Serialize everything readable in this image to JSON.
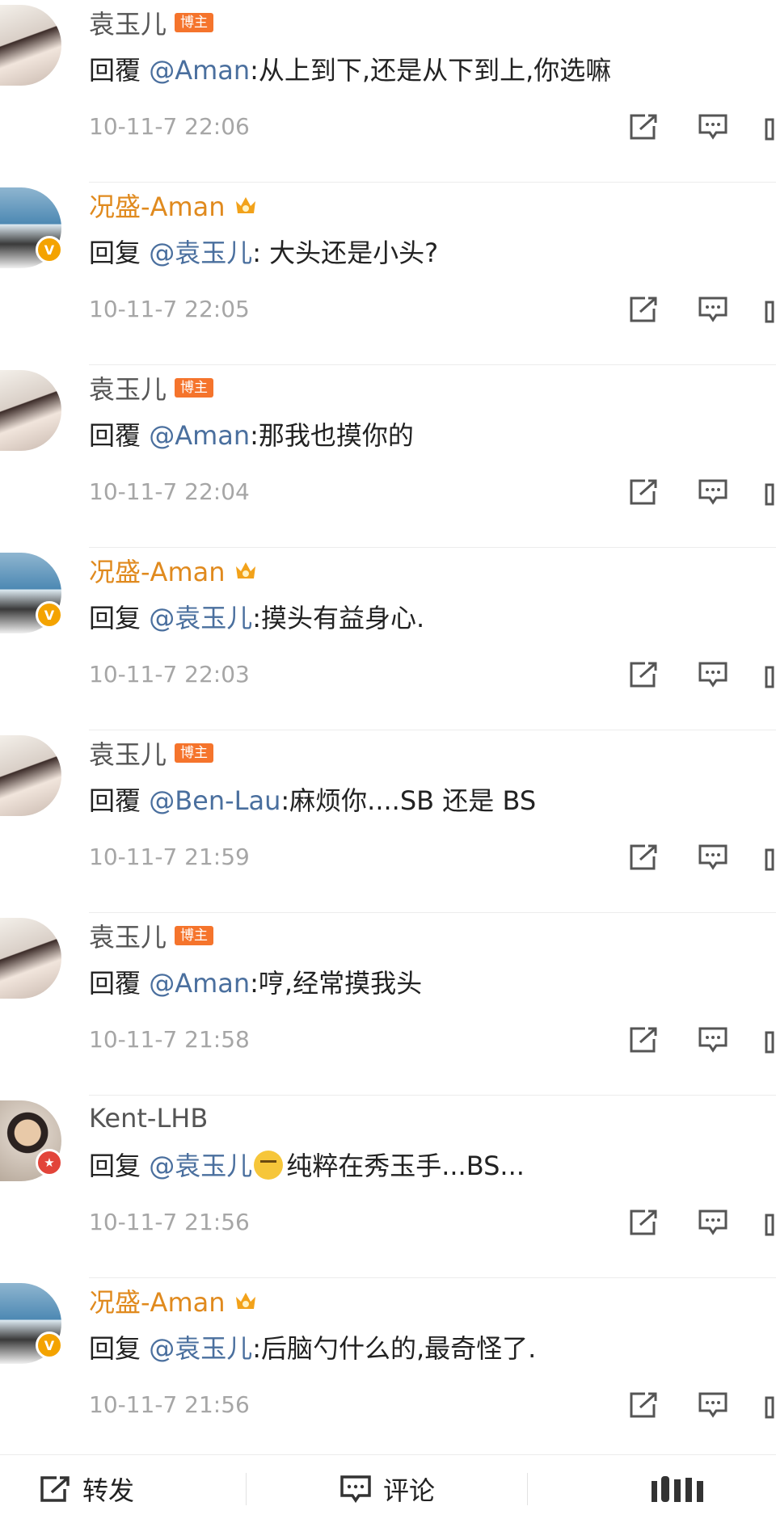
{
  "comments": [
    {
      "name": "袁玉儿",
      "name_color": "gray",
      "tag": "博主",
      "prefix": "回覆 ",
      "mention": "@Aman",
      "rest": ":从上到下,还是从下到上,你选嘛",
      "time": "10-11-7 22:06",
      "avatar": "girl",
      "badge": "none",
      "emoji": false
    },
    {
      "name": "况盛-Aman",
      "name_color": "orange",
      "tag": "",
      "prefix": "回复 ",
      "mention": "@袁玉儿",
      "rest": ": 大头还是小头?",
      "time": "10-11-7 22:05",
      "avatar": "sea",
      "badge": "v",
      "emoji": false
    },
    {
      "name": "袁玉儿",
      "name_color": "gray",
      "tag": "博主",
      "prefix": "回覆 ",
      "mention": "@Aman",
      "rest": ":那我也摸你的",
      "time": "10-11-7 22:04",
      "avatar": "girl",
      "badge": "none",
      "emoji": false
    },
    {
      "name": "况盛-Aman",
      "name_color": "orange",
      "tag": "",
      "prefix": "回复 ",
      "mention": "@袁玉儿",
      "rest": ":摸头有益身心.",
      "time": "10-11-7 22:03",
      "avatar": "sea",
      "badge": "v",
      "emoji": false
    },
    {
      "name": "袁玉儿",
      "name_color": "gray",
      "tag": "博主",
      "prefix": "回覆 ",
      "mention": "@Ben-Lau",
      "rest": ":麻烦你....SB 还是 BS",
      "time": "10-11-7 21:59",
      "avatar": "girl",
      "badge": "none",
      "emoji": false
    },
    {
      "name": "袁玉儿",
      "name_color": "gray",
      "tag": "博主",
      "prefix": "回覆 ",
      "mention": "@Aman",
      "rest": ":哼,经常摸我头",
      "time": "10-11-7 21:58",
      "avatar": "girl",
      "badge": "none",
      "emoji": false
    },
    {
      "name": "Kent-LHB",
      "name_color": "gray",
      "tag": "",
      "prefix": "回复 ",
      "mention": "@袁玉儿",
      "rest": "纯粹在秀玉手...BS...",
      "time": "10-11-7 21:56",
      "avatar": "man",
      "badge": "red",
      "emoji": true
    },
    {
      "name": "况盛-Aman",
      "name_color": "orange",
      "tag": "",
      "prefix": "回复 ",
      "mention": "@袁玉儿",
      "rest": ":后脑勺什么的,最奇怪了.",
      "time": "10-11-7 21:56",
      "avatar": "sea",
      "badge": "v",
      "emoji": false
    }
  ],
  "badges": {
    "v": "V",
    "red": "★"
  },
  "bottom_bar": {
    "repost_label": "转发",
    "comment_label": "评论"
  },
  "colors": {
    "accent_orange": "#e08a1e",
    "mention_blue": "#4a6f9e",
    "tag_orange": "#f5742c",
    "vip_gold": "#f4a300"
  }
}
